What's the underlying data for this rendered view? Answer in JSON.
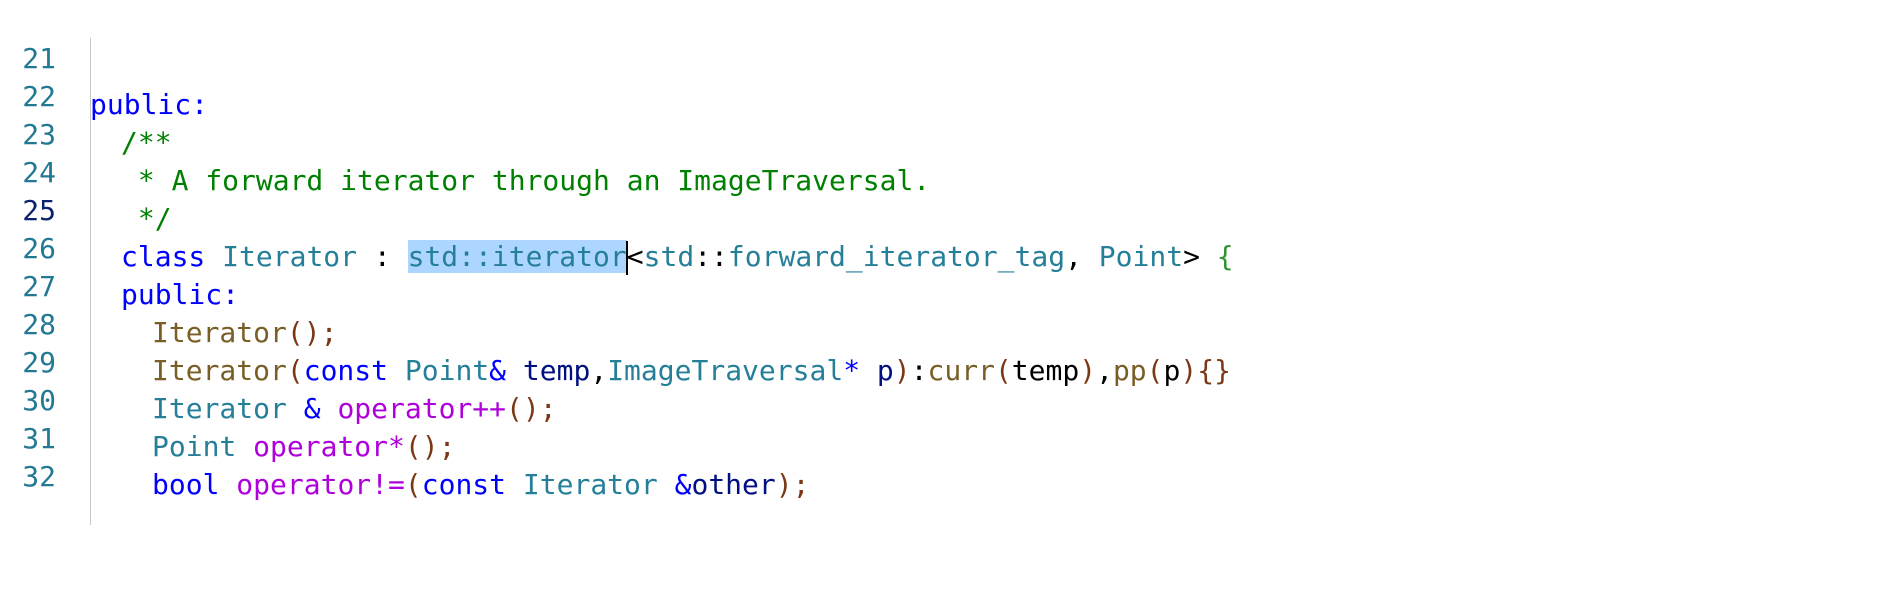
{
  "editor": {
    "language": "cpp",
    "selection_text": "std::iterator",
    "line_numbers": [
      "21",
      "22",
      "23",
      "24",
      "25",
      "26",
      "27",
      "28",
      "29",
      "30",
      "31",
      "32"
    ],
    "colors": {
      "keyword": "#0000ff",
      "type": "#267f99",
      "function": "#795e26",
      "operator_name": "#af00db",
      "comment": "#008000",
      "variable": "#001080",
      "line_number": "#237893",
      "selection": "#add6ff"
    },
    "lines": [
      {
        "tokens": [
          "public:"
        ]
      },
      {
        "tokens": [
          "/**"
        ]
      },
      {
        "tokens": [
          " * A forward iterator through an ImageTraversal."
        ]
      },
      {
        "tokens": [
          " */"
        ]
      },
      {
        "tokens": [
          "class",
          " ",
          "Iterator",
          " : ",
          "std::iterator",
          "<",
          "std",
          "::",
          "forward_iterator_tag",
          ", ",
          "Point",
          "> ",
          "{"
        ]
      },
      {
        "tokens": [
          "public:"
        ]
      },
      {
        "tokens": [
          "Iterator",
          "();"
        ]
      },
      {
        "tokens": [
          "Iterator",
          "(",
          "const",
          " ",
          "Point",
          "&",
          " ",
          "temp",
          ",",
          "ImageTraversal",
          "*",
          " ",
          "p",
          ")",
          ":",
          "curr",
          "(",
          "temp",
          ")",
          ",",
          "pp",
          "(",
          "p",
          ")",
          "{}"
        ]
      },
      {
        "tokens": [
          "Iterator",
          " ",
          "&",
          " ",
          "operator++",
          "();"
        ]
      },
      {
        "tokens": [
          "Point",
          " ",
          "operator*",
          "();"
        ]
      },
      {
        "tokens": [
          "bool",
          " ",
          "operator!=",
          "(",
          "const",
          " ",
          "Iterator",
          " ",
          "&",
          "other",
          ");"
        ]
      },
      {
        "tokens": []
      }
    ]
  }
}
